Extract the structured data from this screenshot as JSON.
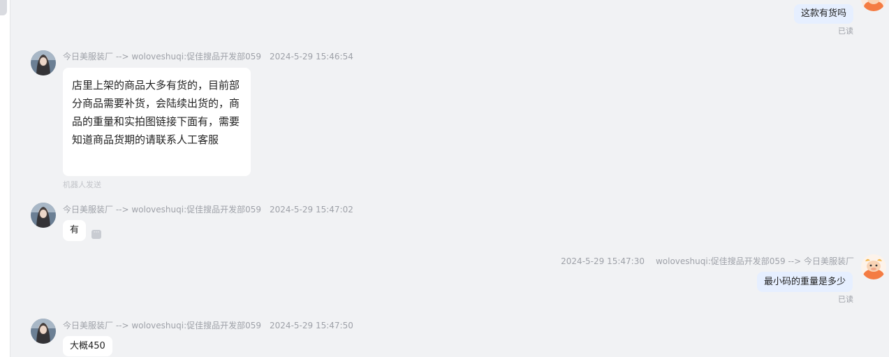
{
  "messages": [
    {
      "id": "m0",
      "direction": "outgoing",
      "text": "这款有货吗",
      "status": "已读"
    },
    {
      "id": "m1",
      "direction": "incoming",
      "sender": "今日美服装厂 --> woloveshuqi:促佳搜品开发部059",
      "time": "2024-5-29 15:46:54",
      "text": "店里上架的商品大多有货的，目前部分商品需要补货，会陆续出货的，商品的重量和实拍图链接下面有，需要知道商品货期的请联系人工客服",
      "footnote": "机器人发送"
    },
    {
      "id": "m2",
      "direction": "incoming",
      "sender": "今日美服装厂 --> woloveshuqi:促佳搜品开发部059",
      "time": "2024-5-29 15:47:02",
      "text": "有"
    },
    {
      "id": "m3",
      "direction": "outgoing",
      "time": "2024-5-29 15:47:30",
      "sender": "woloveshuqi:促佳搜品开发部059 --> 今日美服装厂",
      "text": "最小码的重量是多少",
      "status": "已读"
    },
    {
      "id": "m4",
      "direction": "incoming",
      "sender": "今日美服装厂 --> woloveshuqi:促佳搜品开发部059",
      "time": "2024-5-29 15:47:50",
      "text": "大概450"
    }
  ],
  "icons": {
    "incoming_avatar": "user-avatar-photo",
    "outgoing_avatar": "cow-mascot-avatar",
    "more": "ellipsis-icon"
  },
  "colors": {
    "background": "#f1f2f4",
    "incoming_bubble": "#ffffff",
    "outgoing_bubble": "#e6efff",
    "meta_text": "#9ea1a8",
    "mascot_orange": "#f47c43"
  }
}
